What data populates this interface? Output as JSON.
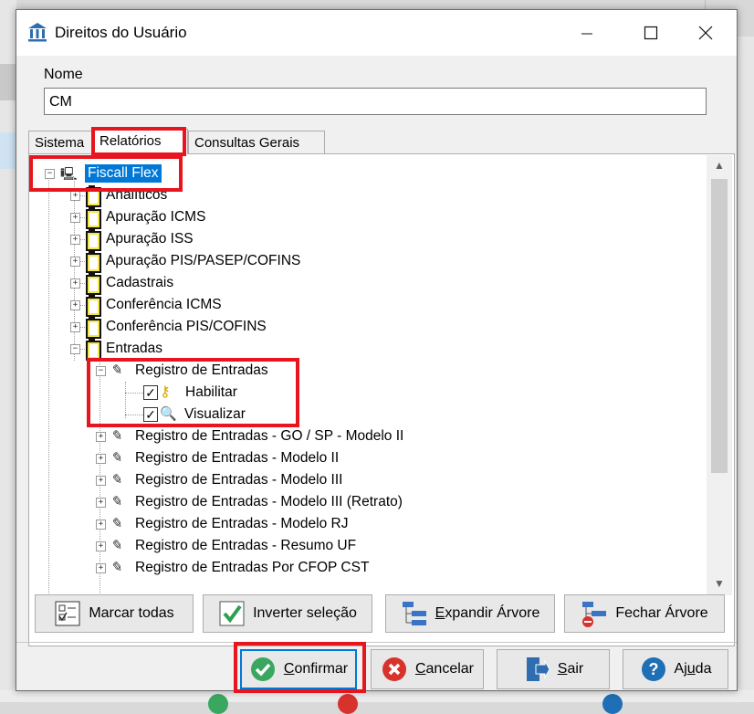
{
  "window": {
    "title": "Direitos do Usuário"
  },
  "nome": {
    "label": "Nome",
    "value": "CM"
  },
  "tabs": [
    {
      "label": "Sistema"
    },
    {
      "label": "Relatórios"
    },
    {
      "label": "Consultas Gerais"
    }
  ],
  "tree": {
    "root": "Fiscall Flex",
    "items": [
      "Analíticos",
      "Apuração ICMS",
      "Apuração ISS",
      "Apuração PIS/PASEP/COFINS",
      "Cadastrais",
      "Conferência ICMS",
      "Conferência PIS/COFINS",
      "Entradas"
    ],
    "entradas_children": [
      "Registro de Entradas",
      "Registro de Entradas - GO / SP - Modelo II",
      "Registro de Entradas - Modelo II",
      "Registro de Entradas - Modelo III",
      "Registro de Entradas - Modelo III (Retrato)",
      "Registro de Entradas - Modelo RJ",
      "Registro de Entradas - Resumo UF",
      "Registro de Entradas Por CFOP CST"
    ],
    "registro_permissions": [
      {
        "label": "Habilitar",
        "checked": true
      },
      {
        "label": "Visualizar",
        "checked": true
      }
    ]
  },
  "tree_buttons": {
    "marcar_todas": "Marcar todas",
    "inverter_selecao": "Inverter seleção",
    "expandir_pre": "",
    "expandir_u": "E",
    "expandir_post": "xpandir Árvore",
    "fechar": "Fechar Árvore"
  },
  "footer_buttons": {
    "confirmar_pre": "",
    "confirmar_u": "C",
    "confirmar_post": "onfirmar",
    "cancelar_pre": "",
    "cancelar_u": "C",
    "cancelar_post": "ancelar",
    "sair_pre": "",
    "sair_u": "S",
    "sair_post": "air",
    "ajuda_pre": "Aj",
    "ajuda_u": "u",
    "ajuda_post": "da"
  },
  "colors": {
    "highlight": "#e8141e",
    "selection": "#0078d7"
  }
}
